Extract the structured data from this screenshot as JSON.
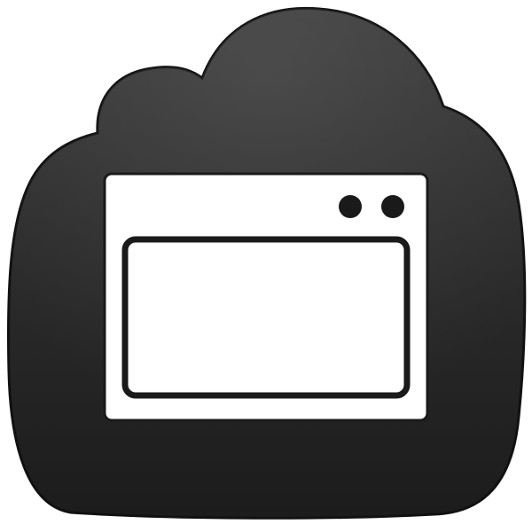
{
  "icon": {
    "name": "application-window-icon",
    "background_shape": "cloud",
    "colors": {
      "page_background": "#ffffff",
      "cloud_top": "#3a3a3a",
      "cloud_bottom": "#1c1c1c",
      "cloud_edge": "#111111",
      "glyph": "#ffffff",
      "glyph_outline": "#1a1a1a"
    },
    "window_title_dots": 2
  }
}
